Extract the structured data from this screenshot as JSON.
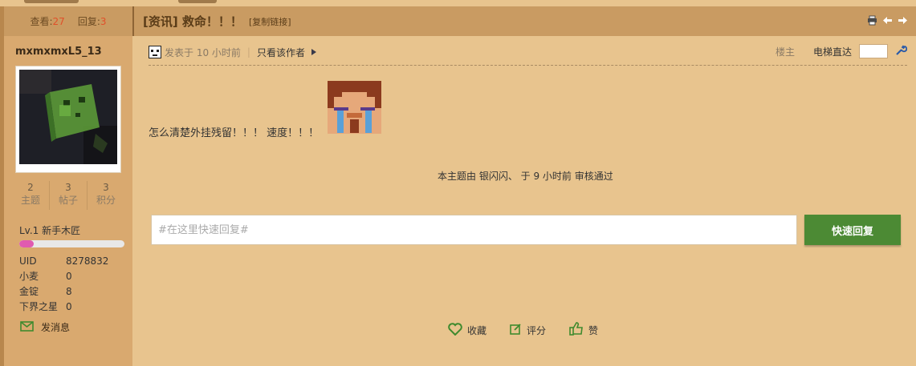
{
  "header": {
    "views_label": "查看:",
    "views_count": "27",
    "replies_label": "回复:",
    "replies_count": "3",
    "thread_title": "[资讯] 救命！！！",
    "copy_link": "[复制链接]"
  },
  "user": {
    "name": "mxmxmxL5_13",
    "stats": [
      {
        "value": "2",
        "label": "主题"
      },
      {
        "value": "3",
        "label": "帖子"
      },
      {
        "value": "3",
        "label": "积分"
      }
    ],
    "level": "Lv.1 新手木匠",
    "level_progress": 0.14,
    "info": [
      {
        "key": "UID",
        "value": "8278832"
      },
      {
        "key": "小麦",
        "value": "0"
      },
      {
        "key": "金锭",
        "value": "8"
      },
      {
        "key": "下界之星",
        "value": "0"
      }
    ],
    "send_message": "发消息"
  },
  "post": {
    "posted_time": "发表于 10 小时前",
    "only_author": "只看该作者",
    "floor_label": "楼主",
    "jump_label": "电梯直达",
    "content": "怎么清楚外挂残留！！！ 速度！！！",
    "review_note": "本主题由 银闪闪、 于 9 小时前 审核通过"
  },
  "reply": {
    "placeholder": "#在这里快速回复#",
    "button": "快速回复"
  },
  "actions": {
    "favorite": "收藏",
    "rate": "评分",
    "like": "赞"
  },
  "colors": {
    "background": "#e8c48e",
    "header": "#c99b62",
    "sidebar": "#d9a96f",
    "reply_button": "#4c8a34",
    "count_accent": "#e0502a"
  }
}
